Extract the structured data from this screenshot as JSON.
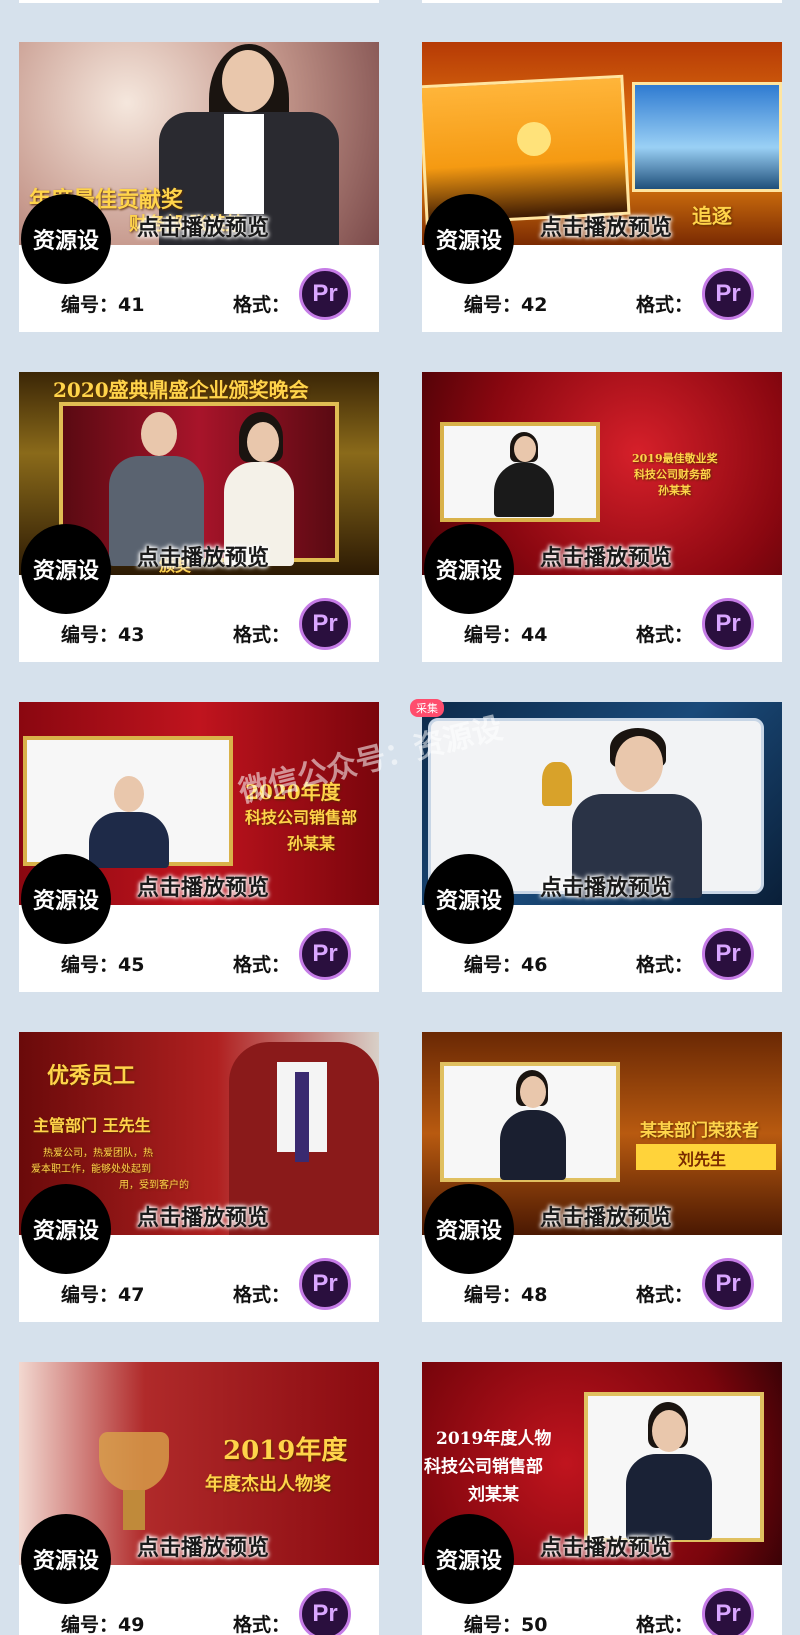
{
  "play_label": "点击播放预览",
  "badge_text": "资源设",
  "number_prefix": "编号：",
  "format_label": "格式：",
  "format_icon": "Pr",
  "collect_tag": "采集",
  "watermark": "微信公众号：资源设",
  "cards": [
    {
      "number": "41",
      "thumb_texts": [
        "年度最佳贡献奖",
        "财务部 张某某"
      ]
    },
    {
      "number": "42",
      "thumb_texts": [
        "追逐"
      ]
    },
    {
      "number": "43",
      "thumb_texts": [
        "2020盛典鼎盛企业颁奖晚会",
        "颁奖"
      ]
    },
    {
      "number": "44",
      "thumb_texts": [
        "2019最佳敬业奖",
        "科技公司财务部",
        "孙某某"
      ]
    },
    {
      "number": "45",
      "thumb_texts": [
        "2020年度",
        "科技公司销售部",
        "孙某某"
      ]
    },
    {
      "number": "46",
      "thumb_texts": []
    },
    {
      "number": "47",
      "thumb_texts": [
        "优秀员工",
        "主管部门 王先生",
        "热爱公司，热爱团队，热",
        "爱本职工作，能够处处起到",
        "用，受到客户的"
      ]
    },
    {
      "number": "48",
      "thumb_texts": [
        "某某部门荣获者",
        "刘先生"
      ]
    },
    {
      "number": "49",
      "thumb_texts": [
        "2019年度",
        "年度杰出人物奖"
      ]
    },
    {
      "number": "50",
      "thumb_texts": [
        "2019年度人物",
        "科技公司销售部",
        "刘某某"
      ]
    }
  ],
  "colors": {
    "page_bg": "#d6e1ec",
    "badge_bg": "#000000",
    "pr_ring": "#c57ce6",
    "pr_fill": "#2a0f3e"
  }
}
